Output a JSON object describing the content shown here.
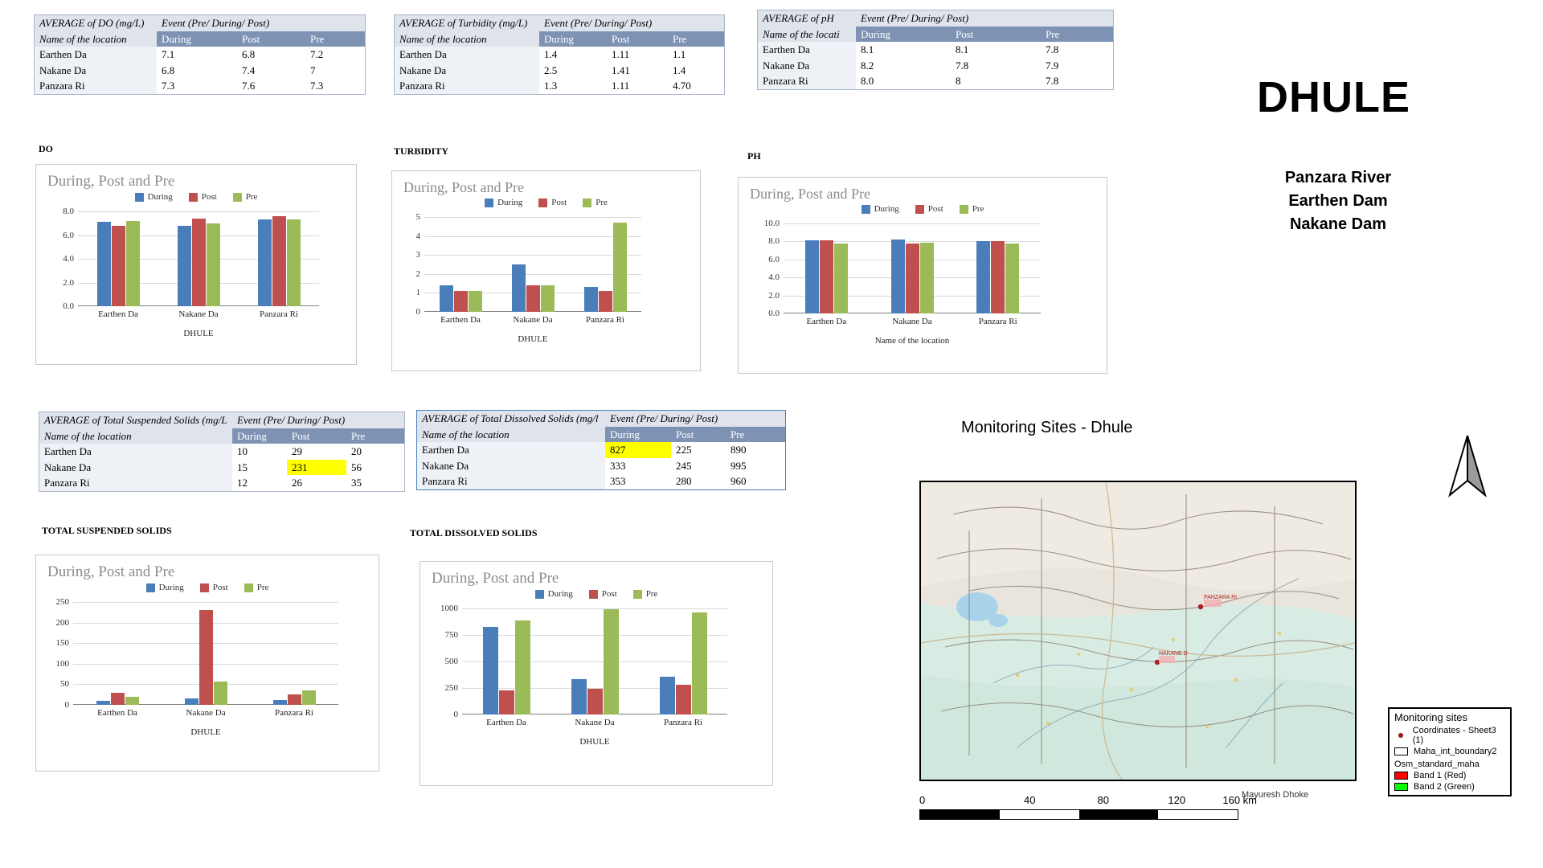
{
  "header": {
    "district": "DHULE",
    "subtitle_lines": [
      "Panzara River",
      "Earthen Dam",
      "Nakane Dam"
    ]
  },
  "series_names": {
    "during": "During",
    "post": "Post",
    "pre": "Pre"
  },
  "colors": {
    "during": "#4a7ebb",
    "post": "#bf504d",
    "pre": "#9bbb59",
    "header_band": "#7e93b4",
    "title_band": "#dfe4ec",
    "highlight": "#ffff00",
    "band1": "#ff0000",
    "band2": "#00ff00"
  },
  "tables": [
    {
      "id": "do",
      "title": "AVERAGE of DO (mg/L)",
      "event_header": "Event (Pre/ During/ Post)",
      "loc_header": "Name of the location",
      "columns": [
        "During",
        "Post",
        "Pre"
      ],
      "rows": [
        {
          "location": "Earthen Da",
          "values": [
            "7.1",
            "6.8",
            "7.2"
          ]
        },
        {
          "location": "Nakane Da",
          "values": [
            "6.8",
            "7.4",
            "7"
          ]
        },
        {
          "location": "Panzara Ri",
          "values": [
            "7.3",
            "7.6",
            "7.3"
          ]
        }
      ]
    },
    {
      "id": "turbidity",
      "title": "AVERAGE of Turbidity (mg/L)",
      "event_header": "Event (Pre/ During/ Post)",
      "loc_header": "Name of the location",
      "columns": [
        "During",
        "Post",
        "Pre"
      ],
      "rows": [
        {
          "location": "Earthen Da",
          "values": [
            "1.4",
            "1.11",
            "1.1"
          ]
        },
        {
          "location": "Nakane Da",
          "values": [
            "2.5",
            "1.41",
            "1.4"
          ]
        },
        {
          "location": "Panzara Ri",
          "values": [
            "1.3",
            "1.11",
            "4.70"
          ]
        }
      ]
    },
    {
      "id": "ph",
      "title": "AVERAGE of pH",
      "event_header": "Event (Pre/ During/ Post)",
      "loc_header": "Name of the locati",
      "columns": [
        "During",
        "Post",
        "Pre"
      ],
      "rows": [
        {
          "location": "Earthen Da",
          "values": [
            "8.1",
            "8.1",
            "7.8"
          ]
        },
        {
          "location": "Nakane Da",
          "values": [
            "8.2",
            "7.8",
            "7.9"
          ]
        },
        {
          "location": "Panzara Ri",
          "values": [
            "8.0",
            "8",
            "7.8"
          ]
        }
      ]
    },
    {
      "id": "tss",
      "title": "AVERAGE of Total Suspended Solids (mg/L",
      "event_header": "Event (Pre/ During/ Post)",
      "loc_header": "Name of the location",
      "columns": [
        "During",
        "Post",
        "Pre"
      ],
      "rows": [
        {
          "location": "Earthen Da",
          "values": [
            "10",
            "29",
            "20"
          ]
        },
        {
          "location": "Nakane Da",
          "values": [
            "15",
            "231",
            "56"
          ],
          "highlight": 1
        },
        {
          "location": "Panzara Ri",
          "values": [
            "12",
            "26",
            "35"
          ]
        }
      ]
    },
    {
      "id": "tds",
      "title": "AVERAGE of Total Dissolved Solids (mg/l",
      "event_header": "Event (Pre/ During/ Post)",
      "loc_header": "Name of the location",
      "columns": [
        "During",
        "Post",
        "Pre"
      ],
      "rows": [
        {
          "location": "Earthen Da",
          "values": [
            "827",
            "225",
            "890"
          ],
          "highlight": 0
        },
        {
          "location": "Nakane Da",
          "values": [
            "333",
            "245",
            "995"
          ]
        },
        {
          "location": "Panzara Ri",
          "values": [
            "353",
            "280",
            "960"
          ]
        }
      ]
    }
  ],
  "chart_data": [
    {
      "id": "do",
      "section_label": "DO",
      "type": "bar",
      "title": "During, Post and Pre",
      "xlabel": "DHULE",
      "ylabel": "",
      "categories": [
        "Earthen Da",
        "Nakane Da",
        "Panzara Ri"
      ],
      "series": [
        {
          "name": "During",
          "values": [
            7.1,
            6.8,
            7.3
          ]
        },
        {
          "name": "Post",
          "values": [
            6.8,
            7.4,
            7.6
          ]
        },
        {
          "name": "Pre",
          "values": [
            7.2,
            7.0,
            7.3
          ]
        }
      ],
      "yticks": [
        "0.0",
        "2.0",
        "4.0",
        "6.0",
        "8.0"
      ],
      "ylim": [
        0,
        8
      ],
      "grid": true,
      "legend_position": "top"
    },
    {
      "id": "turbidity",
      "section_label": "TURBIDITY",
      "type": "bar",
      "title": "During, Post and Pre",
      "xlabel": "DHULE",
      "ylabel": "",
      "categories": [
        "Earthen Da",
        "Nakane Da",
        "Panzara Ri"
      ],
      "series": [
        {
          "name": "During",
          "values": [
            1.4,
            2.5,
            1.3
          ]
        },
        {
          "name": "Post",
          "values": [
            1.11,
            1.41,
            1.11
          ]
        },
        {
          "name": "Pre",
          "values": [
            1.1,
            1.4,
            4.7
          ]
        }
      ],
      "yticks": [
        "0",
        "1",
        "2",
        "3",
        "4",
        "5"
      ],
      "ylim": [
        0,
        5
      ],
      "grid": true,
      "legend_position": "top"
    },
    {
      "id": "ph",
      "section_label": "PH",
      "type": "bar",
      "title": "During, Post and Pre",
      "xlabel": "Name of the location",
      "ylabel": "",
      "categories": [
        "Earthen Da",
        "Nakane Da",
        "Panzara Ri"
      ],
      "series": [
        {
          "name": "During",
          "values": [
            8.1,
            8.2,
            8.0
          ]
        },
        {
          "name": "Post",
          "values": [
            8.1,
            7.8,
            8.0
          ]
        },
        {
          "name": "Pre",
          "values": [
            7.8,
            7.9,
            7.8
          ]
        }
      ],
      "yticks": [
        "0.0",
        "2.0",
        "4.0",
        "6.0",
        "8.0",
        "10.0"
      ],
      "ylim": [
        0,
        10
      ],
      "grid": true,
      "legend_position": "top"
    },
    {
      "id": "tss",
      "section_label": "TOTAL SUSPENDED SOLIDS",
      "type": "bar",
      "title": "During, Post and Pre",
      "xlabel": "DHULE",
      "ylabel": "",
      "categories": [
        "Earthen Da",
        "Nakane Da",
        "Panzara Ri"
      ],
      "series": [
        {
          "name": "During",
          "values": [
            10,
            15,
            12
          ]
        },
        {
          "name": "Post",
          "values": [
            29,
            231,
            26
          ]
        },
        {
          "name": "Pre",
          "values": [
            20,
            56,
            35
          ]
        }
      ],
      "yticks": [
        "0",
        "50",
        "100",
        "150",
        "200",
        "250"
      ],
      "ylim": [
        0,
        250
      ],
      "grid": true,
      "legend_position": "top"
    },
    {
      "id": "tds",
      "section_label": "TOTAL DISSOLVED SOLIDS",
      "type": "bar",
      "title": "During, Post and Pre",
      "xlabel": "DHULE",
      "ylabel": "",
      "categories": [
        "Earthen Da",
        "Nakane Da",
        "Panzara Ri"
      ],
      "series": [
        {
          "name": "During",
          "values": [
            827,
            333,
            353
          ]
        },
        {
          "name": "Post",
          "values": [
            225,
            245,
            280
          ]
        },
        {
          "name": "Pre",
          "values": [
            890,
            995,
            960
          ]
        }
      ],
      "yticks": [
        "0",
        "250",
        "500",
        "750",
        "1000"
      ],
      "ylim": [
        0,
        1000
      ],
      "grid": true,
      "legend_position": "top"
    }
  ],
  "map": {
    "title": "Monitoring Sites - Dhule",
    "site_labels": [
      "PANZARA RI",
      "NAKANE D"
    ],
    "author": "Mayuresh Dhoke",
    "scale": {
      "ticks": [
        "0",
        "40",
        "80",
        "120",
        "160 km"
      ]
    },
    "legend": {
      "title": "Monitoring sites",
      "items": [
        {
          "symbol": "dot",
          "label": "Coordinates - Sheet3 (1)"
        },
        {
          "symbol": "outline",
          "label": "Maha_int_boundary2"
        }
      ],
      "group_label": "Osm_standard_maha",
      "bands": [
        {
          "color": "#ff0000",
          "label": "Band 1 (Red)"
        },
        {
          "color": "#00ff00",
          "label": "Band 2 (Green)"
        }
      ]
    },
    "north_arrow": "north-arrow"
  }
}
